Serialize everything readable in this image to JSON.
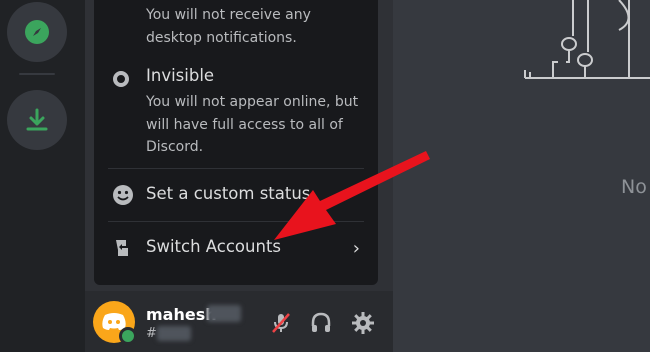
{
  "popup": {
    "dnd_description": "You will not receive any desktop notifications.",
    "invisible_title": "Invisible",
    "invisible_description": "You will not appear online, but will have full access to all of Discord.",
    "custom_status_label": "Set a custom status",
    "switch_accounts_label": "Switch Accounts",
    "chevron": "›"
  },
  "user": {
    "name": "mahesh",
    "discriminator": "#",
    "status_color": "#3ba55d",
    "avatar_color": "#faa61a"
  },
  "main": {
    "partial_text": "No"
  },
  "colors": {
    "accent_green": "#3ba55d",
    "arrow_red": "#e8131d"
  },
  "icons": {
    "rail": [
      "compass-icon",
      "download-icon"
    ],
    "panel": [
      "microphone-muted-icon",
      "headphones-icon",
      "gear-icon"
    ]
  }
}
